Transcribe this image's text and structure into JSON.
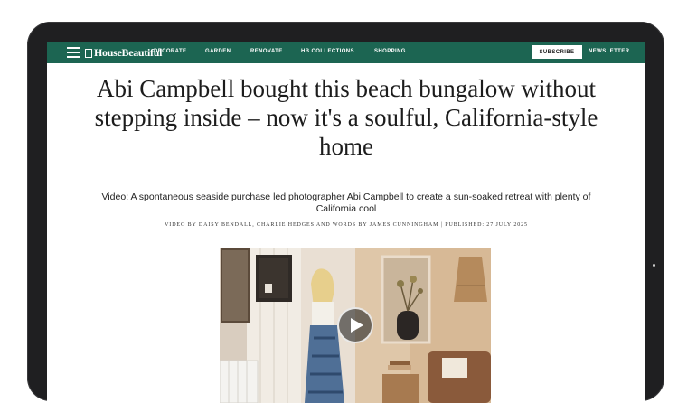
{
  "nav": {
    "logo": "HouseBeautiful",
    "links": [
      "DECORATE",
      "GARDEN",
      "RENOVATE",
      "HB COLLECTIONS",
      "SHOPPING"
    ],
    "subscribe": "SUBSCRIBE",
    "newsletter": "NEWSLETTER"
  },
  "article": {
    "headline": "Abi Campbell bought this beach bungalow without stepping inside – now it's a soulful, California-style home",
    "dek": "Video: A spontaneous seaside purchase led photographer Abi Campbell to create a sun-soaked retreat with plenty of California cool",
    "byline": "VIDEO BY DAISY BENDALL, CHARLIE HEDGES AND WORDS BY JAMES CUNNINGHAM  |  PUBLISHED: 27 JULY 2025"
  },
  "icons": {
    "menu": "hamburger-menu-icon",
    "play": "play-icon"
  },
  "colors": {
    "nav_background": "#1c6552",
    "device_frame": "#1f1f21"
  }
}
